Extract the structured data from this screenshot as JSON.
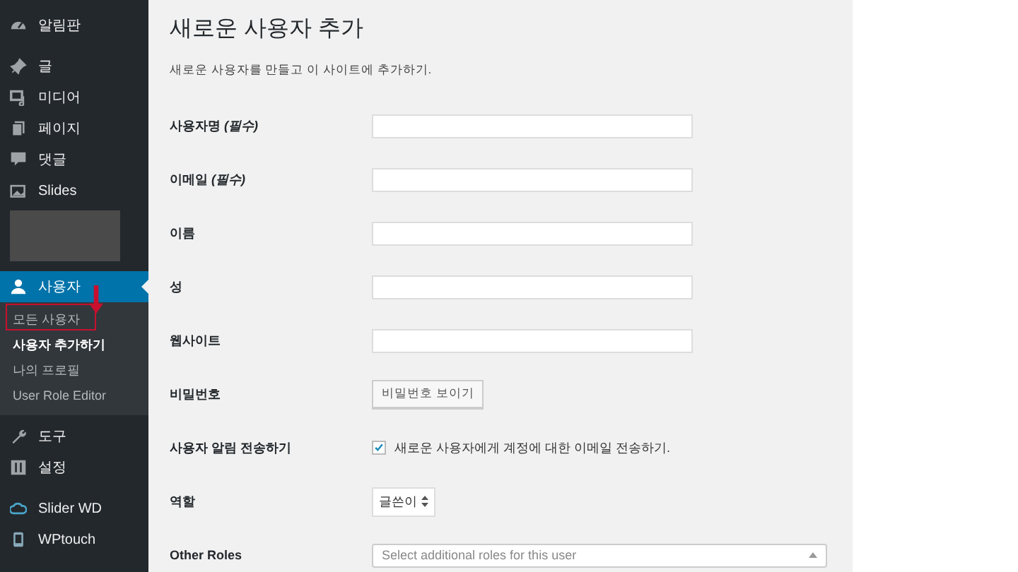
{
  "sidebar": {
    "items": [
      {
        "kind": "item",
        "label": "알림판",
        "selected": false
      },
      {
        "kind": "item",
        "label": "글",
        "selected": false
      },
      {
        "kind": "item",
        "label": "미디어",
        "selected": false
      },
      {
        "kind": "item",
        "label": "페이지",
        "selected": false
      },
      {
        "kind": "item",
        "label": "댓글",
        "selected": false
      },
      {
        "kind": "item",
        "label": "Slides",
        "selected": false
      },
      {
        "kind": "blank"
      },
      {
        "kind": "item",
        "label": "사용자",
        "selected": true,
        "submenu": [
          {
            "label": "모든 사용자",
            "selected": false
          },
          {
            "label": "사용자 추가하기",
            "selected": true
          },
          {
            "label": "나의 프로필",
            "selected": false
          },
          {
            "label": "User Role Editor",
            "selected": false
          }
        ]
      },
      {
        "kind": "item",
        "label": "도구",
        "selected": false
      },
      {
        "kind": "item",
        "label": "설정",
        "selected": false
      },
      {
        "kind": "item",
        "label": "Slider WD",
        "selected": false
      },
      {
        "kind": "item",
        "label": "WPtouch",
        "selected": false
      }
    ]
  },
  "page": {
    "title": "새로운 사용자 추가",
    "description": "새로운 사용자를 만들고 이 사이트에 추가하기.",
    "fields": [
      {
        "kind": "text",
        "label": "사용자명 *(필수)*"
      },
      {
        "kind": "text",
        "label": "이메일 *(필수)*"
      },
      {
        "kind": "text",
        "label": "이름"
      },
      {
        "kind": "text",
        "label": "성"
      },
      {
        "kind": "text",
        "label": "웹사이트"
      },
      {
        "kind": "button",
        "label": "비밀번호",
        "button": "비밀번호 보이기"
      },
      {
        "kind": "checkbox",
        "label": "사용자 알림 전송하기",
        "checked": true,
        "text": "새로운 사용자에게 계정에 대한 이메일 전송하기."
      },
      {
        "kind": "select",
        "label": "역할",
        "value": "글쓴이"
      },
      {
        "kind": "multiselect",
        "label": "Other Roles",
        "placeholder": "Select additional roles for this user"
      }
    ]
  }
}
